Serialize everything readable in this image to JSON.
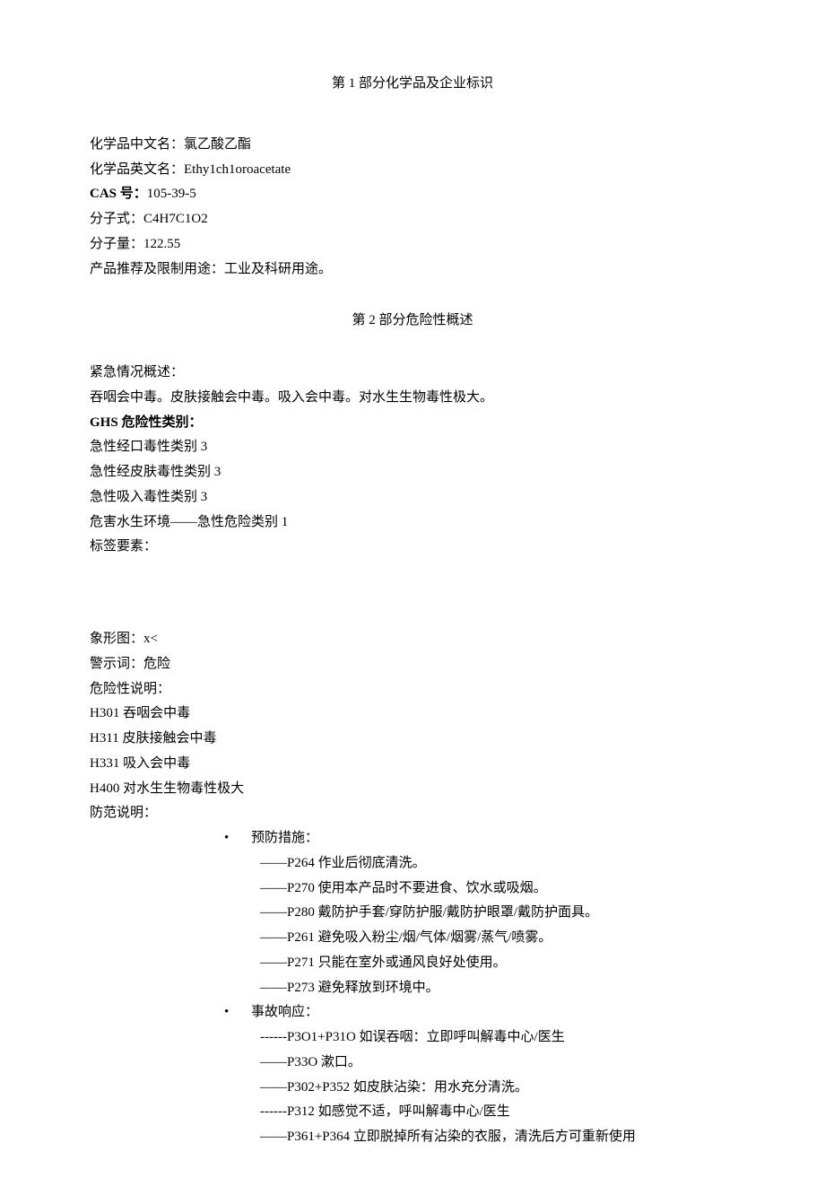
{
  "section1": {
    "title": "第 1 部分化学品及企业标识",
    "name_cn_label": "化学品中文名：",
    "name_cn": "氯乙酸乙酯",
    "name_en_label": "化学品英文名：",
    "name_en": "Ethy1ch1oroacetate",
    "cas_label": "CAS",
    "cas_label_suffix": " 号：",
    "cas": "105-39-5",
    "formula_label": "分子式：",
    "formula": "C4H7C1O2",
    "weight_label": "分子量：",
    "weight": "122.55",
    "usage_label": "产品推荐及限制用途：",
    "usage": "工业及科研用途。"
  },
  "section2": {
    "title": "第 2 部分危险性概述",
    "emergency_label": "紧急情况概述：",
    "emergency_desc": "吞咽会中毒。皮肤接触会中毒。吸入会中毒。对水生生物毒性极大。",
    "ghs_label": "GHS",
    "ghs_label_suffix": " 危险性类别：",
    "ghs_categories": [
      "急性经口毒性类别 3",
      "急性经皮肤毒性类别 3",
      "急性吸入毒性类别 3",
      "危害水生环境——急性危险类别 1"
    ],
    "label_elements": "标签要素：",
    "pictogram_label": "象形图：",
    "pictogram": "x<",
    "signal_label": "警示词：",
    "signal": "危险",
    "hazard_label": "危险性说明：",
    "hazard_statements": [
      "H301 吞咽会中毒",
      "H311 皮肤接触会中毒",
      "H331 吸入会中毒",
      "H400 对水生生物毒性极大"
    ],
    "precaution_label": "防范说明：",
    "prevention_title": "预防措施：",
    "prevention_items": [
      "——P264 作业后彻底清洗。",
      "——P270 使用本产品时不要进食、饮水或吸烟。",
      "——P280 戴防护手套/穿防护服/戴防护眼罩/戴防护面具。",
      "——P261 避免吸入粉尘/烟/气体/烟雾/蒸气/喷雾。",
      "——P271 只能在室外或通风良好处使用。",
      "——P273 避免释放到环境中。"
    ],
    "response_title": "事故响应：",
    "response_items": [
      "------P3O1+P31O 如误吞咽：立即呼叫解毒中心/医生",
      "——P33O 漱口。",
      "——P302+P352 如皮肤沾染：用水充分清洗。",
      "------P312 如感觉不适，呼叫解毒中心/医生",
      "——P361+P364 立即脱掉所有沾染的衣服，清洗后方可重新使用"
    ]
  }
}
